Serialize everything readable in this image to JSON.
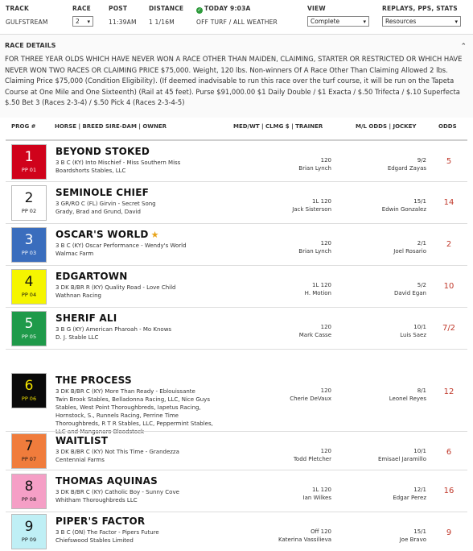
{
  "header": {
    "track_label": "TRACK",
    "track_value": "GULFSTREAM",
    "race_label": "RACE",
    "race_value": "2",
    "post_label": "POST",
    "post_value": "11:39AM",
    "distance_label": "DISTANCE",
    "distance_value": "1 1/16M",
    "today_label": "TODAY 9:03A",
    "surface_value": "OFF TURF / ALL WEATHER",
    "view_label": "VIEW",
    "view_value": "Complete",
    "replays_label": "REPLAYS, PPS, STATS",
    "replays_value": "Resources"
  },
  "details": {
    "title": "RACE DETAILS",
    "text": "FOR THREE YEAR OLDS WHICH HAVE NEVER WON A RACE OTHER THAN MAIDEN, CLAIMING, STARTER OR RESTRICTED OR WHICH HAVE NEVER WON TWO RACES OR CLAIMING PRICE $75,000. Weight, 120 lbs. Non-winners Of A Race Other Than Claiming Allowed 2 lbs. Claiming Price $75,000 (Condition Eligibility). (If deemed inadvisable to run this race over the turf course, it will be run on the Tapeta Course at One Mile and One Sixteenth) (Rail at 45 feet). Purse $91,000.00 $1 Daily Double / $1 Exacta / $.50 Trifecta / $.10 Superfecta $.50 Bet 3 (Races 2-3-4) / $.50 Pick 4 (Races 2-3-4-5)"
  },
  "columns": {
    "prog": "PROG #",
    "horse": "HORSE | BREED SIRE-DAM | OWNER",
    "medwt": "MED/WT | CLMG $ | TRAINER",
    "mlodds": "M/L ODDS | JOCKEY",
    "odds": "ODDS"
  },
  "entries": [
    {
      "num": "1",
      "pp": "PP 01",
      "name": "BEYOND STOKED",
      "star": "",
      "breed": "3 B C (KY) Into Mischief - Miss Southern Miss",
      "owner": "Boardshorts Stables, LLC",
      "wt": "120",
      "trainer": "Brian Lynch",
      "ml": "9/2",
      "jockey": "Edgard Zayas",
      "odds": "5",
      "bg": "#d0021b",
      "fg": "#ffffff"
    },
    {
      "num": "2",
      "pp": "PP 02",
      "name": "SEMINOLE CHIEF",
      "star": "",
      "breed": "3 GR/RO C (FL) Girvin - Secret Song",
      "owner": "Grady, Brad and Grund, David",
      "wt": "1L 120",
      "trainer": "Jack Sisterson",
      "ml": "15/1",
      "jockey": "Edwin Gonzalez",
      "odds": "14",
      "bg": "#ffffff",
      "fg": "#111111"
    },
    {
      "num": "3",
      "pp": "PP 03",
      "name": "OSCAR'S WORLD",
      "star": "★",
      "breed": "3 B C (KY) Oscar Performance - Wendy's World",
      "owner": "Walmac Farm",
      "wt": "120",
      "trainer": "Brian Lynch",
      "ml": "2/1",
      "jockey": "Joel Rosario",
      "odds": "2",
      "bg": "#3a6dbd",
      "fg": "#ffffff"
    },
    {
      "num": "4",
      "pp": "PP 04",
      "name": "EDGARTOWN",
      "star": "",
      "breed": "3 DK B/BR R (KY) Quality Road - Love Child",
      "owner": "Wathnan Racing",
      "wt": "1L 120",
      "trainer": "H. Motion",
      "ml": "5/2",
      "jockey": "David Egan",
      "odds": "10",
      "bg": "#f5f500",
      "fg": "#111111"
    },
    {
      "num": "5",
      "pp": "PP 05",
      "name": "SHERIF ALI",
      "star": "",
      "breed": "3 B G (KY) American Pharoah - Mo Knows",
      "owner": "D. J. Stable LLC",
      "wt": "120",
      "trainer": "Mark Casse",
      "ml": "10/1",
      "jockey": "Luis Saez",
      "odds": "7/2",
      "bg": "#1f9a4a",
      "fg": "#ffffff"
    },
    {
      "num": "6",
      "pp": "PP 06",
      "name": "THE PROCESS",
      "star": "",
      "breed": "3 DK B/BR C (KY) More Than Ready - Eblouissante",
      "owner": "Twin Brook Stables, Belladonna Racing, LLC, Nice Guys Stables, West Point Thoroughbreds, Iapetus Racing, Hornstock, S., Runnels Racing, Perrine Time Thoroughbreds, R T R Stables, LLC, Peppermint Stables, LLC and Manganaro Bloodstock",
      "wt": "120",
      "trainer": "Cherie DeVaux",
      "ml": "8/1",
      "jockey": "Leonel Reyes",
      "odds": "12",
      "bg": "#0a0a0a",
      "fg": "#f5e600"
    },
    {
      "num": "7",
      "pp": "PP 07",
      "name": "WAITLIST",
      "star": "",
      "breed": "3 DK B/BR C (KY) Not This Time - Grandezza",
      "owner": "Centennial Farms",
      "wt": "120",
      "trainer": "Todd Pletcher",
      "ml": "10/1",
      "jockey": "Emisael Jaramillo",
      "odds": "6",
      "bg": "#f07c3c",
      "fg": "#111111"
    },
    {
      "num": "8",
      "pp": "PP 08",
      "name": "THOMAS AQUINAS",
      "star": "",
      "breed": "3 DK B/BR C (KY) Catholic Boy - Sunny Cove",
      "owner": "Whitham Thoroughbreds LLC",
      "wt": "1L 120",
      "trainer": "Ian Wilkes",
      "ml": "12/1",
      "jockey": "Edgar Perez",
      "odds": "16",
      "bg": "#f59fc6",
      "fg": "#111111"
    },
    {
      "num": "9",
      "pp": "PP 09",
      "name": "PIPER'S FACTOR",
      "star": "",
      "breed": "3 B C (ON) The Factor - Pipers Future",
      "owner": "Chiefswood Stables Limited",
      "wt": "Off 120",
      "trainer": "Katerina Vassilieva",
      "ml": "15/1",
      "jockey": "Joe Bravo",
      "odds": "9",
      "bg": "#bfeff5",
      "fg": "#111111"
    }
  ]
}
